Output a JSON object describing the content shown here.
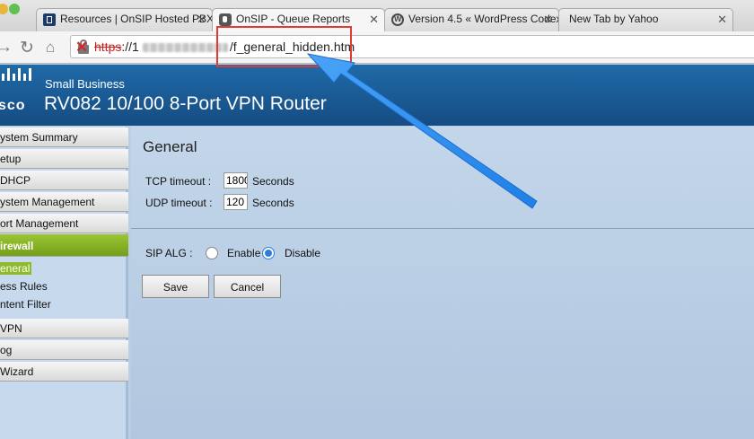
{
  "browser": {
    "tabs": [
      {
        "title": "Resources | OnSIP Hosted PBX",
        "favicon": "onsip-icon"
      },
      {
        "title": "OnSIP - Queue Reports",
        "favicon": "onsip-icon"
      },
      {
        "title": "Version 4.5 « WordPress Codex",
        "favicon": "wordpress-icon"
      },
      {
        "title": "New Tab by Yahoo",
        "favicon": ""
      }
    ],
    "address": {
      "scheme": "https",
      "separator": "://",
      "host_prefix": "1",
      "path": "/f_general_hidden.htm"
    },
    "colors": {
      "annotation": "#e13a2e",
      "arrow": "#2c8ef0"
    }
  },
  "router": {
    "logo_text": "sco",
    "brand_small": "Small Business",
    "model_title": "RV082  10/100 8-Port VPN Router"
  },
  "sidebar": {
    "items": [
      {
        "label": "ystem Summary"
      },
      {
        "label": "etup"
      },
      {
        "label": "DHCP"
      },
      {
        "label": "ystem Management"
      },
      {
        "label": "ort Management"
      },
      {
        "label": "irewall"
      },
      {
        "label": "VPN"
      },
      {
        "label": "og"
      },
      {
        "label": "Wizard"
      }
    ],
    "sub_items": [
      {
        "label": "eneral"
      },
      {
        "label": "ess Rules"
      },
      {
        "label": "ntent Filter"
      }
    ],
    "active_color": "#8cba2a"
  },
  "content": {
    "title": "General",
    "tcp_label": "TCP timeout :",
    "tcp_value": "1800",
    "udp_label": "UDP timeout :",
    "udp_value": "120",
    "units": "Seconds",
    "sip_alg_label": "SIP ALG :",
    "enable_label": "Enable",
    "disable_label": "Disable",
    "sip_alg_selected": "Disable",
    "save_label": "Save",
    "cancel_label": "Cancel"
  }
}
